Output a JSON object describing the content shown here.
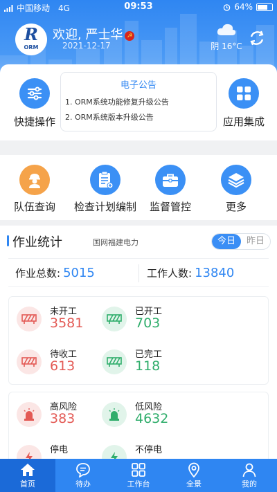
{
  "status_bar": {
    "carrier": "中国移动",
    "network": "4G",
    "time": "09:53",
    "battery": "64%"
  },
  "header": {
    "welcome": "欢迎, 严士华",
    "date": "2021-12-17",
    "weather": "阴 16°C",
    "logo_letter": "R",
    "logo_text": "ORM",
    "colors": {
      "primary": "#2f86f2",
      "red": "#e35a55",
      "green": "#2fad6b"
    }
  },
  "quick": {
    "left_label": "快捷操作",
    "right_label": "应用集成"
  },
  "notice": {
    "title": "电子公告",
    "items": [
      "1. ORM系统功能修复升级公告",
      "2. ORM系统版本升级公告"
    ]
  },
  "grid": [
    {
      "label": "队伍查询",
      "icon": "worker-icon"
    },
    {
      "label": "检查计划编制",
      "icon": "clipboard-icon"
    },
    {
      "label": "监督管控",
      "icon": "briefcase-icon"
    },
    {
      "label": "更多",
      "icon": "layers-icon"
    }
  ],
  "stats": {
    "title": "作业统计",
    "org": "国网福建电力",
    "today": "今日",
    "yesterday": "昨日",
    "total_label": "作业总数:",
    "total_value": "5015",
    "workers_label": "工作人数:",
    "workers_value": "13840",
    "work": [
      {
        "label": "未开工",
        "value": "3581",
        "tone": "red"
      },
      {
        "label": "已开工",
        "value": "703",
        "tone": "green"
      },
      {
        "label": "待收工",
        "value": "613",
        "tone": "red"
      },
      {
        "label": "已完工",
        "value": "118",
        "tone": "green"
      }
    ],
    "risk": [
      {
        "label": "高风险",
        "value": "383",
        "tone": "red"
      },
      {
        "label": "低风险",
        "value": "4632",
        "tone": "green"
      },
      {
        "label": "停电",
        "tone": "red"
      },
      {
        "label": "不停电",
        "tone": "green"
      }
    ]
  },
  "tabbar": [
    {
      "label": "首页",
      "icon": "home-icon",
      "active": true
    },
    {
      "label": "待办",
      "icon": "chat-icon"
    },
    {
      "label": "工作台",
      "icon": "grid-icon"
    },
    {
      "label": "全景",
      "icon": "location-icon"
    },
    {
      "label": "我的",
      "icon": "user-icon"
    }
  ]
}
